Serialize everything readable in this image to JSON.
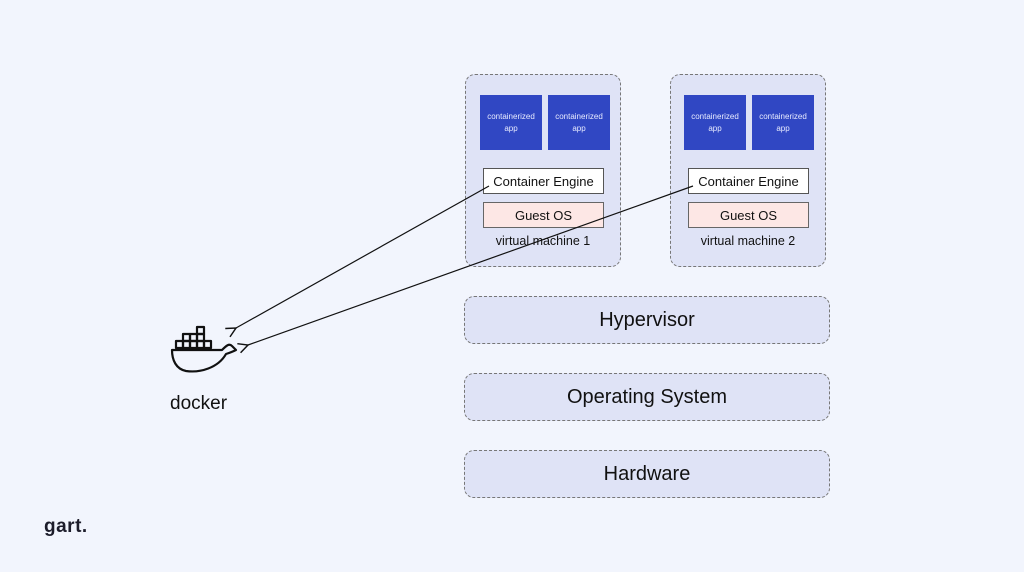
{
  "virtual_machines": [
    {
      "label": "virtual machine 1",
      "apps": [
        "containerized app",
        "containerized app"
      ],
      "engine": "Container Engine",
      "guest_os": "Guest OS"
    },
    {
      "label": "virtual machine 2",
      "apps": [
        "containerized app",
        "containerized app"
      ],
      "engine": "Container Engine",
      "guest_os": "Guest OS"
    }
  ],
  "layers": {
    "hypervisor": "Hypervisor",
    "operating_system": "Operating System",
    "hardware": "Hardware"
  },
  "docker": {
    "label": "docker",
    "icon": "docker-whale-icon"
  },
  "logo": {
    "text": "gart."
  },
  "colors": {
    "background": "#f2f5fd",
    "box_fill": "#dfe3f6",
    "app_fill": "#3047c3",
    "guest_os_fill": "#fde7e5"
  }
}
